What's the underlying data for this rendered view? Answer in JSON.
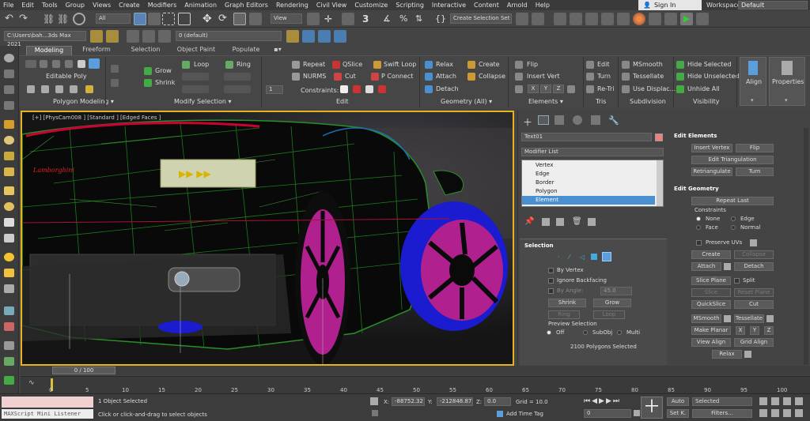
{
  "menubar": {
    "items": [
      "File",
      "Edit",
      "Tools",
      "Group",
      "Views",
      "Create",
      "Modifiers",
      "Animation",
      "Graph Editors",
      "Rendering",
      "Civil View",
      "Customize",
      "Scripting",
      "Interactive",
      "Content",
      "Arnold",
      "Help"
    ],
    "signin": "Sign In",
    "workspaces_label": "Workspaces:",
    "workspaces_value": "Default"
  },
  "toolbar": {
    "selection_filter": "All",
    "ref_coord": "View",
    "selection_set": "Create Selection Set",
    "project_path": "C:\\Users\\bah...3ds Max 2021",
    "layer": "0 (default)"
  },
  "ribbon": {
    "tabs": [
      "Modeling",
      "Freeform",
      "Selection",
      "Object Paint",
      "Populate"
    ],
    "active_tab": "Modeling",
    "editable_poly": "Editable Poly",
    "grow": "Grow",
    "shrink": "Shrink",
    "loop": "Loop",
    "ring": "Ring",
    "repeat": "Repeat",
    "qslice": "QSlice",
    "swift_loop": "Swift Loop",
    "nurms": "NURMS",
    "cut": "Cut",
    "p_connect": "P Connect",
    "constraints": "Constraints:",
    "relax": "Relax",
    "create": "Create",
    "attach": "Attach",
    "collapse": "Collapse",
    "detach": "Detach",
    "flip": "Flip",
    "insert_vert": "Insert Vert",
    "x": "X",
    "y": "Y",
    "z": "Z",
    "edit": "Edit",
    "turn": "Turn",
    "retri": "Re-Tri",
    "msmooth": "MSmooth",
    "tessellate": "Tessellate",
    "use_displac": "Use Displac...",
    "hide_selected": "Hide Selected",
    "hide_unselected": "Hide Unselected",
    "unhide_all": "Unhide All",
    "align": "Align",
    "properties": "Properties",
    "sections": {
      "polygon_modeling": "Polygon Modeling ▾",
      "modify_selection": "Modify Selection ▾",
      "edit": "Edit",
      "geometry_all": "Geometry (All) ▾",
      "elements": "Elements ▾",
      "tris": "Tris",
      "subdivision": "Subdivision",
      "visibility": "Visibility"
    },
    "spinner_value": "1"
  },
  "viewport": {
    "label": "[+] [PhysCam008 ] [Standard ] [Edged Faces ]",
    "badge": "Lamborghini"
  },
  "command_panel": {
    "object_name": "Text01",
    "object_color": "#f08080",
    "modifier_list": "Modifier List",
    "stack": [
      "Vertex",
      "Edge",
      "Border",
      "Polygon",
      "Element"
    ],
    "selected": "Element",
    "selection": {
      "title": "Selection",
      "by_vertex": "By Vertex",
      "ignore_backfacing": "Ignore Backfacing",
      "by_angle": "By Angle:",
      "by_angle_value": "45.0",
      "shrink": "Shrink",
      "grow": "Grow",
      "ring": "Ring",
      "loop": "Loop",
      "preview_selection": "Preview Selection",
      "off": "Off",
      "subobj": "SubObj",
      "multi": "Multi",
      "status": "2100 Polygons Selected"
    }
  },
  "edit_elements": {
    "title": "Edit Elements",
    "insert_vertex": "Insert Vertex",
    "flip": "Flip",
    "edit_triangulation": "Edit Triangulation",
    "retriangulate": "Retriangulate",
    "turn": "Turn"
  },
  "edit_geometry": {
    "title": "Edit Geometry",
    "repeat_last": "Repeat Last",
    "constraints": "Constraints",
    "none": "None",
    "edge": "Edge",
    "face": "Face",
    "normal": "Normal",
    "preserve_uvs": "Preserve UVs",
    "create": "Create",
    "collapse": "Collapse",
    "attach": "Attach",
    "detach": "Detach",
    "slice_plane": "Slice Plane",
    "split": "Split",
    "slice": "Slice",
    "reset_plane": "Reset Plane",
    "quickslice": "QuickSlice",
    "cut": "Cut",
    "msmooth": "MSmooth",
    "tessellate": "Tessellate",
    "make_planar": "Make Planar",
    "x": "X",
    "y": "Y",
    "z": "Z",
    "view_align": "View Align",
    "grid_align": "Grid Align",
    "relax": "Relax"
  },
  "timeline": {
    "slider": "0 / 100",
    "ticks": [
      "0",
      "5",
      "10",
      "15",
      "20",
      "25",
      "30",
      "35",
      "40",
      "45",
      "50",
      "55",
      "60",
      "65",
      "70",
      "75",
      "80",
      "85",
      "90",
      "95",
      "100"
    ]
  },
  "status": {
    "maxscript": "MAXScript Mini Listener",
    "objects_selected": "1 Object Selected",
    "prompt": "Click or click-and-drag to select objects",
    "x_label": "X:",
    "x_value": "-88752.32",
    "y_label": "Y:",
    "y_value": "-212848.875",
    "z_label": "Z:",
    "z_value": "0.0",
    "grid": "Grid = 10.0",
    "add_time_tag": "Add Time Tag",
    "auto": "Auto",
    "selected": "Selected",
    "set_k": "Set K.",
    "filters": "Filters...",
    "frame": "0"
  }
}
